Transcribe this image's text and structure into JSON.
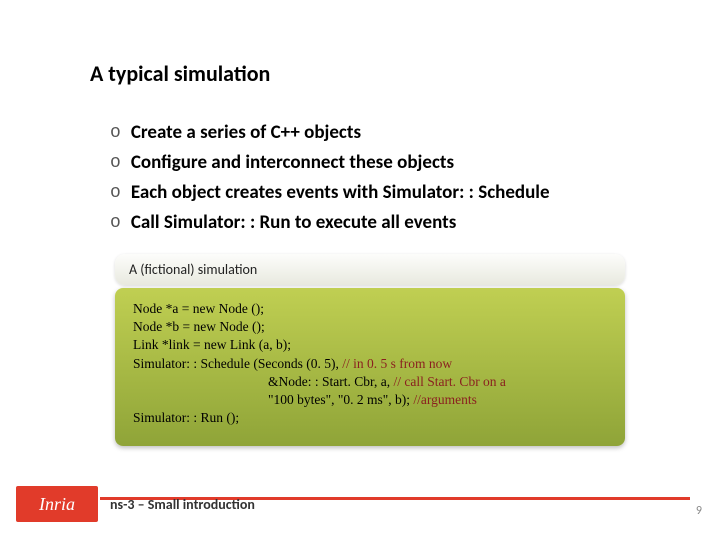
{
  "title": "A typical simulation",
  "bullets": [
    "Create a series of C++ objects",
    "Configure and interconnect these objects",
    "Each object creates events with Simulator: : Schedule",
    "Call Simulator: : Run to execute all events"
  ],
  "bullet_marker": "o",
  "subtitle": "A (fictional) simulation",
  "code": {
    "l1": "Node *a = new Node ();",
    "l2": "Node *b = new Node ();",
    "l3": "Link *link = new Link (a, b);",
    "l4a": "Simulator: : Schedule (Seconds (0. 5), ",
    "l4b": "// in 0. 5 s from now",
    "l5a": "                                        &Node: : Start. Cbr, a, ",
    "l5b": "// call Start. Cbr on a",
    "l6a": "                                        \"100 bytes\", \"0. 2 ms\", b); ",
    "l6b": "//arguments",
    "l7": "Simulator: : Run ();"
  },
  "logo_text": "Inria",
  "footer": "ns-3 – Small introduction",
  "page_number": "9"
}
